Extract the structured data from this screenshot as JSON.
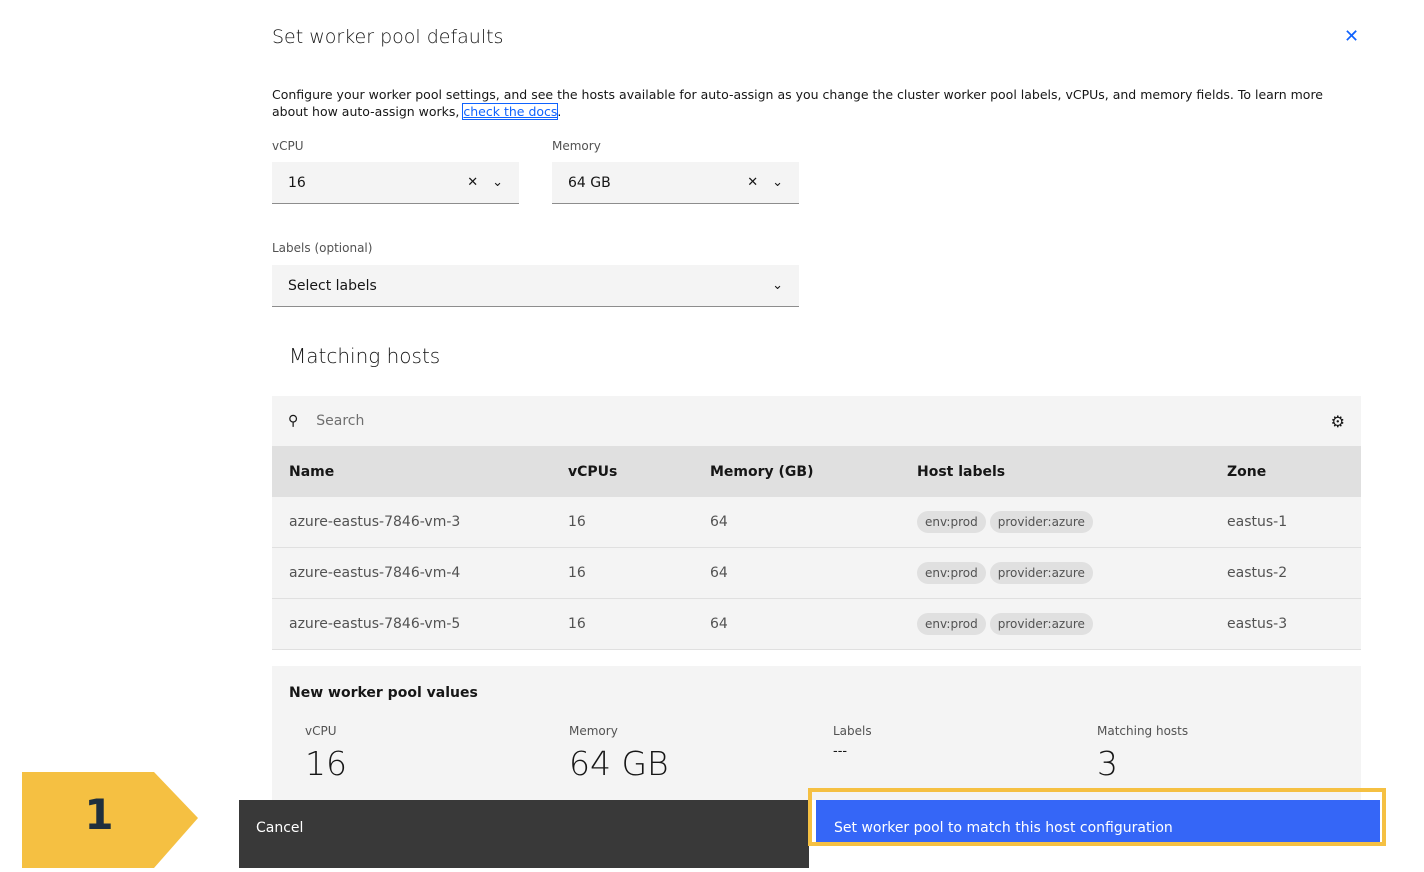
{
  "modal": {
    "title": "Set worker pool defaults",
    "description": "Configure your worker pool settings, and see the hosts available for auto-assign as you change the cluster worker pool labels, vCPUs, and memory fields. To learn more about how auto-assign works, ",
    "docs_link": "check the docs",
    "docs_after": "."
  },
  "form": {
    "vcpu_label": "vCPU",
    "vcpu_value": "16",
    "memory_label": "Memory",
    "memory_value": "64 GB",
    "labels_label": "Labels (optional)",
    "labels_placeholder": "Select labels"
  },
  "matching": {
    "title": "Matching hosts",
    "search_placeholder": "Search",
    "columns": [
      "Name",
      "vCPUs",
      "Memory (GB)",
      "Host labels",
      "Zone"
    ],
    "rows": [
      {
        "name": "azure-eastus-7846-vm-3",
        "vcpus": "16",
        "memory": "64",
        "labels": [
          "env:prod",
          "provider:azure"
        ],
        "zone": "eastus-1"
      },
      {
        "name": "azure-eastus-7846-vm-4",
        "vcpus": "16",
        "memory": "64",
        "labels": [
          "env:prod",
          "provider:azure"
        ],
        "zone": "eastus-2"
      },
      {
        "name": "azure-eastus-7846-vm-5",
        "vcpus": "16",
        "memory": "64",
        "labels": [
          "env:prod",
          "provider:azure"
        ],
        "zone": "eastus-3"
      }
    ]
  },
  "summary": {
    "title": "New worker pool values",
    "vcpu_label": "vCPU",
    "vcpu": "16",
    "memory_label": "Memory",
    "memory": "64 GB",
    "labels_label": "Labels",
    "labels": "---",
    "hosts_label": "Matching hosts",
    "hosts": "3"
  },
  "footer": {
    "cancel": "Cancel",
    "primary": "Set worker pool to match this host configuration"
  },
  "callout": {
    "number": "1",
    "color": "#f5c042"
  }
}
